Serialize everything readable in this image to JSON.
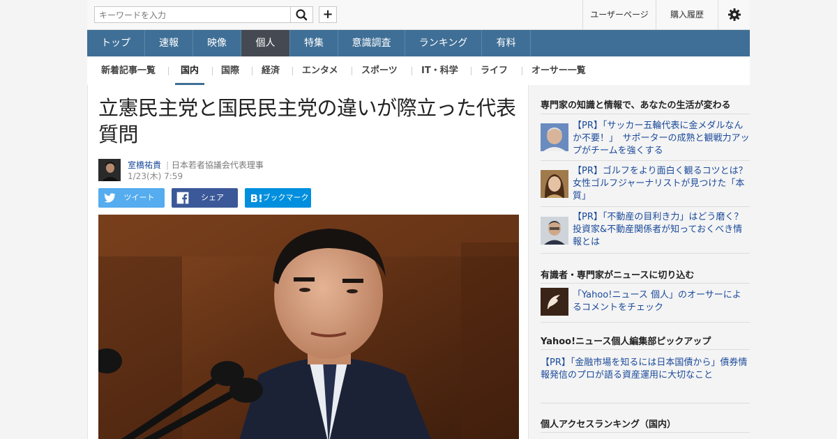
{
  "header": {
    "search_placeholder": "キーワードを入力",
    "user_page": "ユーザーページ",
    "purchase_history": "購入履歴"
  },
  "global_nav": [
    "トップ",
    "速報",
    "映像",
    "個人",
    "特集",
    "意識調査",
    "ランキング",
    "有料"
  ],
  "global_nav_active": "個人",
  "sub_nav": [
    "新着記事一覧",
    "国内",
    "国際",
    "経済",
    "エンタメ",
    "スポーツ",
    "IT・科学",
    "ライフ",
    "オーサー一覧"
  ],
  "sub_nav_active": "国内",
  "article": {
    "title": "立憲民主党と国民民主党の違いが際立った代表質問",
    "author_name": "室橋祐貴",
    "author_title": "日本若者協議会代表理事",
    "date": "1/23(木) 7:59"
  },
  "share": {
    "tweet": "ツイート",
    "facebook": "シェア",
    "hatena": "ブックマーク"
  },
  "sidebar": {
    "expert_heading": "専門家の知識と情報で、あなたの生活が変わる",
    "expert_items": [
      "【PR】「サッカー五輪代表に金メダルなんか不要！」　サポーターの成熟と観戦力アップがチームを強くする",
      "【PR】ゴルフをより面白く観るコツとは？　女性ゴルフジャーナリストが見つけた「本質」",
      "【PR】「不動産の目利き力」はどう磨く？　投資家&不動産関係者が知っておくべき情報とは"
    ],
    "comment_heading": "有識者・専門家がニュースに切り込む",
    "comment_item": "「Yahoo!ニュース 個人」のオーサーによるコメントをチェック",
    "pickup_heading": "Yahoo!ニュース個人編集部ピックアップ",
    "pickup_item": "【PR】「金融市場を知るには日本国債から」債券情報発信のプロが語る資産運用に大切なこと",
    "ranking_heading": "個人アクセスランキング（国内）"
  },
  "colors": {
    "nav_blue": "#3f6f96",
    "nav_active": "#454a52",
    "link_blue": "#1a4a9a",
    "twitter": "#55acee",
    "facebook": "#3b5998",
    "hatena": "#008fde"
  }
}
